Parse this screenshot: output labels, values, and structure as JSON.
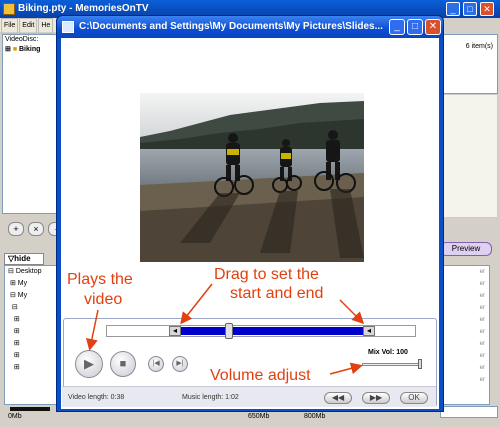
{
  "background_app": {
    "title": "Biking.pty - MemoriesOnTV",
    "menu": [
      "File",
      "Edit",
      "He"
    ],
    "tree": [
      "VideoDisc:",
      "Biking"
    ],
    "item_count": "6 item(s)",
    "hide_label": "hide",
    "preview_label": "Preview",
    "lower_tree": [
      "Desktop",
      "My",
      "My"
    ],
    "scale": [
      "0Mb",
      "650Mb",
      "800Mb"
    ]
  },
  "dialog": {
    "title": "C:\\Documents and Settings\\My Documents\\My Pictures\\Slides...",
    "mix_vol_label": "Mix Vol: 100",
    "mix_volume": 100,
    "video_length_label": "Video length: 0:38",
    "music_length_label": "Music length: 1:02",
    "ok_label": "OK"
  },
  "annotations": {
    "plays": "Plays the\nvideo",
    "plays_line1": "Plays the",
    "plays_line2": "video",
    "drag_line1": "Drag to set the",
    "drag_line2": "start and end",
    "volume": "Volume adjust"
  },
  "colors": {
    "annotation": "#e24010",
    "selection": "#0000cc",
    "title_bar": "#0b4ed0"
  }
}
